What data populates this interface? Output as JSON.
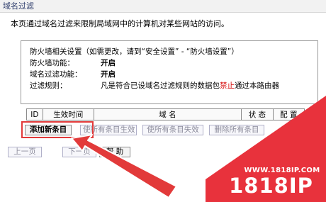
{
  "page": {
    "title": "域名过滤"
  },
  "description": "本页通过域名过滤来限制局域网中的计算机对某些网站的访问。",
  "info": {
    "settings_note": "防火墙相关设置（如需更改，请到“安全设置” - “防火墙设置”）",
    "firewall": {
      "label": "防火墙功能：",
      "value": "开启"
    },
    "domain_filter": {
      "label": "域名过滤功能：",
      "value": "开启"
    },
    "rule": {
      "label": "过滤规则：",
      "text_before": "凡是符合已设域名过滤规则的数据包",
      "text_highlight": "禁止",
      "text_after": "通过本路由器"
    }
  },
  "table": {
    "columns": [
      "ID",
      "生效时间",
      "域  名",
      "状 态",
      "配 置"
    ]
  },
  "actions": {
    "add": "添加新条目",
    "enable_all": "使所有条目生效",
    "disable_all": "使所有条目失效",
    "delete_all": "删除所有条目"
  },
  "nav": {
    "prev": "上一页",
    "next": "下一页",
    "help": "帮 助"
  },
  "watermark": {
    "url": "WWW.1818IP.COM",
    "brand": "1818IP"
  },
  "colors": {
    "highlight": "#e23a3a",
    "danger_text": "#d40000"
  }
}
